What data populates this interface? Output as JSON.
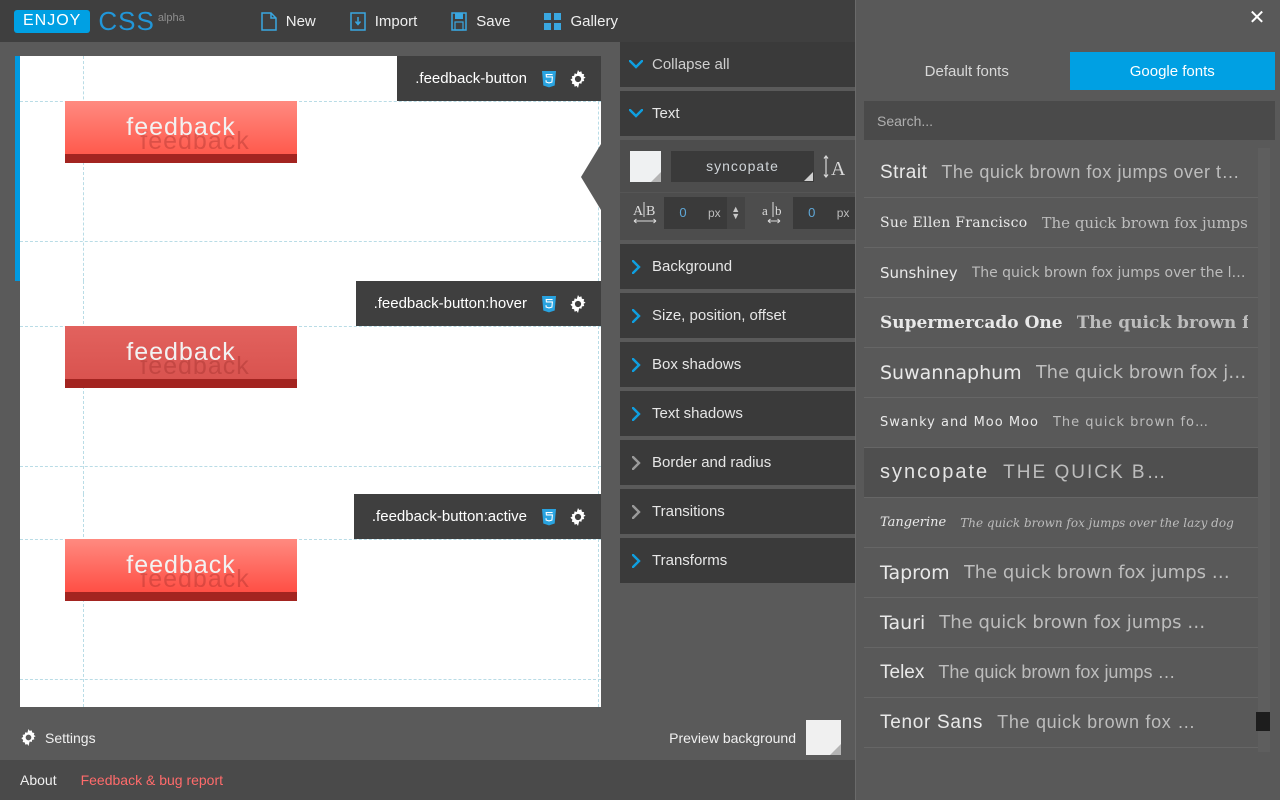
{
  "app": {
    "logo_badge": "ENJOY",
    "logo_name": "CSS",
    "logo_tag": "alpha"
  },
  "topmenu": [
    {
      "label": "New",
      "icon": "new-file-icon"
    },
    {
      "label": "Import",
      "icon": "import-icon"
    },
    {
      "label": "Save",
      "icon": "save-icon"
    },
    {
      "label": "Gallery",
      "icon": "gallery-icon"
    }
  ],
  "preview": {
    "button_text": "feedback",
    "panels": [
      {
        "selector": ".feedback-button",
        "state": "normal"
      },
      {
        "selector": ".feedback-button:hover",
        "state": "hover"
      },
      {
        "selector": ".feedback-button:active",
        "state": "active"
      }
    ],
    "css3_icon": "css3-icon",
    "gear_icon": "gear-icon",
    "collapse_arrow_icon": "chevron-left-icon"
  },
  "preview_bar": {
    "settings_label": "Settings",
    "settings_icon": "gear-icon",
    "preview_background_label": "Preview background",
    "preview_background_color": "#f0f0f0"
  },
  "footer": {
    "about_label": "About",
    "feedback_label": "Feedback & bug report",
    "feedback_color": "#ff6b6b"
  },
  "properties": {
    "collapse_all": "Collapse all",
    "text_section": {
      "title": "Text",
      "color_swatch": "#eff1f2",
      "font_family_value": "syncopate",
      "font_size_icon": "font-size-icon",
      "letter_spacing": {
        "icon": "letter-spacing-icon",
        "value": "0",
        "unit": "px"
      },
      "word_spacing": {
        "icon": "word-spacing-icon",
        "value": "0",
        "unit": "px"
      }
    },
    "sections": [
      "Background",
      "Size, position, offset",
      "Box shadows",
      "Text shadows",
      "Border and radius",
      "Transitions",
      "Transforms"
    ]
  },
  "font_dialog": {
    "close_icon": "close-icon",
    "tabs": [
      {
        "label": "Default fonts",
        "active": false
      },
      {
        "label": "Google fonts",
        "active": true
      }
    ],
    "accent_color": "#00a0e3",
    "search_placeholder": "Search...",
    "search_value": "",
    "fonts": [
      {
        "name": "Strait",
        "sample": "The quick brown fox jumps over t…",
        "selected": false
      },
      {
        "name": "Sue Ellen Francisco",
        "sample": "The quick brown fox jumps over the la…",
        "selected": false
      },
      {
        "name": "Sunshiney",
        "sample": "The quick brown fox jumps over the l…",
        "selected": false
      },
      {
        "name": "Supermercado One",
        "sample": "The quick brown f…",
        "selected": false
      },
      {
        "name": "Suwannaphum",
        "sample": "The quick brown fox j…",
        "selected": false
      },
      {
        "name": "Swanky and Moo Moo",
        "sample": "The quick brown fo…",
        "selected": false
      },
      {
        "name": "syncopate",
        "sample": "The quick b…",
        "selected": true
      },
      {
        "name": "Tangerine",
        "sample": "The quick brown fox jumps over the lazy dog",
        "selected": false
      },
      {
        "name": "Taprom",
        "sample": "The quick brown fox jumps …",
        "selected": false
      },
      {
        "name": "Tauri",
        "sample": "The quick brown fox jumps …",
        "selected": false
      },
      {
        "name": "Telex",
        "sample": "The quick brown fox jumps …",
        "selected": false
      },
      {
        "name": "Tenor Sans",
        "sample": "The quick brown fox …",
        "selected": false
      }
    ]
  }
}
